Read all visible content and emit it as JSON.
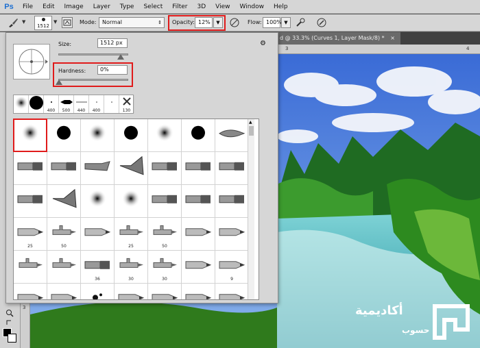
{
  "app": {
    "logo": "Ps"
  },
  "menu": [
    "File",
    "Edit",
    "Image",
    "Layer",
    "Type",
    "Select",
    "Filter",
    "3D",
    "View",
    "Window",
    "Help"
  ],
  "options": {
    "brush_size": "1512",
    "mode_label": "Mode:",
    "mode_value": "Normal",
    "opacity_label": "Opacity:",
    "opacity_value": "12%",
    "flow_label": "Flow:",
    "flow_value": "100%",
    "highlight_color": "#e01a1a"
  },
  "document": {
    "tab_title": "d @ 33.3% (Curves 1, Layer Mask/8) *",
    "close": "×",
    "ruler_top": [
      "3",
      "4"
    ],
    "ruler_left": [
      "3"
    ]
  },
  "picker": {
    "size_label": "Size:",
    "size_value": "1512 px",
    "hardness_label": "Hardness:",
    "hardness_value": "0%",
    "settings_icon": "gear-icon",
    "recent_numbers": [
      "",
      "",
      "400",
      "500",
      "440",
      "400",
      "",
      "130"
    ],
    "grid_numbers": [
      "",
      "",
      "",
      "",
      "",
      "",
      "",
      "",
      "",
      "",
      "",
      "",
      "",
      "",
      "",
      "",
      "",
      "",
      "",
      "",
      "",
      "25",
      "50",
      "",
      "25",
      "50",
      "",
      "",
      "",
      "",
      "36",
      "30",
      "30",
      "",
      "9",
      "",
      "",
      "",
      "",
      "",
      "",
      ""
    ]
  },
  "watermark": {
    "arabic": "أكاديمية",
    "sub": "حسوب"
  }
}
